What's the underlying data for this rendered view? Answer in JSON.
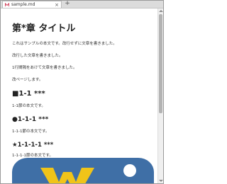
{
  "tab": {
    "title": "sample.md",
    "close": "×",
    "add": "+"
  },
  "document": {
    "h1": "第*章 タイトル",
    "paragraphs": [
      "これはサンプルの本文です。改行せずに文章を書きました。",
      "改行した文章を書きました。",
      "1行間隔をあけて文章を書きました。",
      "改ページします。"
    ],
    "h2": "■1-1 ***",
    "h2_body": "1-1節の本文です。",
    "h3": "●1-1-1 ***",
    "h3_body": "1-1-1節の本文です。",
    "h4": "★1-1-1-1 ***",
    "h4_body": "1-1-1-1節の本文です。"
  },
  "colors": {
    "image_blue": "#3f6fa6",
    "image_yellow": "#f0c419"
  }
}
